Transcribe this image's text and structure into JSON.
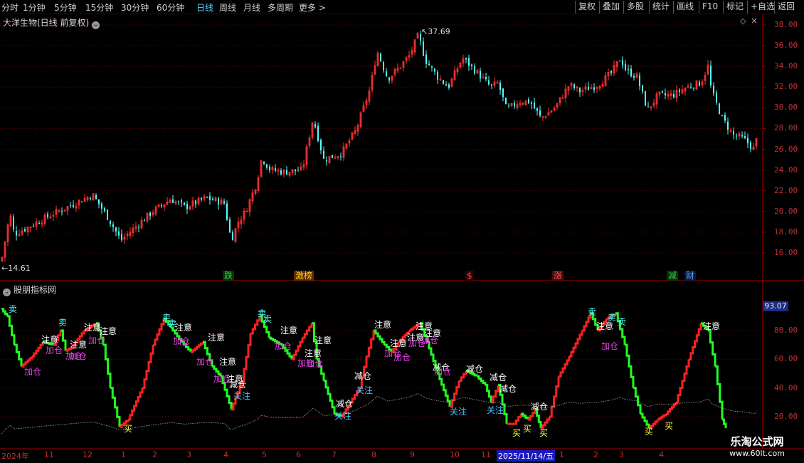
{
  "toolbar": {
    "periods": [
      "分时",
      "1分钟",
      "5分钟",
      "15分钟",
      "30分钟",
      "60分钟",
      "日线",
      "周线",
      "月线",
      "多周期",
      "更多 >"
    ],
    "active_period": "日线",
    "actions": [
      "复权",
      "叠加",
      "多股",
      "统计",
      "画线",
      "F10",
      "标记",
      "+自选",
      "返回"
    ]
  },
  "main_chart": {
    "title": "大洋生物(日线 前复权)",
    "high_label": "37.69",
    "low_label": "14.61",
    "y_ticks": [
      "38.00",
      "36.00",
      "34.00",
      "32.00",
      "30.00",
      "28.00",
      "26.00",
      "24.00",
      "22.00",
      "20.00",
      "18.00",
      "16.00"
    ],
    "events": [
      {
        "text": "跌",
        "color": "#30d040",
        "bg": "#083008"
      },
      {
        "text": "激榜",
        "color": "#ffcc33",
        "bg": "#5a2a00"
      },
      {
        "text": "$",
        "color": "#ff4040",
        "bg": "#300000"
      },
      {
        "text": "涨",
        "color": "#ff5050",
        "bg": "#401010"
      },
      {
        "text": "减",
        "color": "#30d040",
        "bg": "#083008"
      },
      {
        "text": "财",
        "color": "#60a0ff",
        "bg": "#08183a"
      }
    ],
    "colors": {
      "up": "#ff3232",
      "down": "#54ffff",
      "grid": "#6a0000"
    }
  },
  "indicator": {
    "title": "股朋指标网",
    "current_value": "93.07",
    "y_ticks": [
      "80.00",
      "60.00",
      "40.00",
      "20.00"
    ],
    "signals": {
      "sell": "卖",
      "attention": "注意",
      "add": "加仓",
      "reduce": "减仓",
      "watch": "关注",
      "buy": "买"
    },
    "colors": {
      "up": "#ff2020",
      "down": "#20ff20",
      "sell": "#54ffff",
      "attention": "#ffffff",
      "add": "#e040e0",
      "reduce": "#ffffff",
      "watch": "#40c0ff",
      "buy": "#ffff40"
    }
  },
  "date_axis": {
    "labels": [
      "2024年",
      "11",
      "12",
      "1",
      "2",
      "3",
      "4",
      "5",
      "6",
      "7",
      "8",
      "9",
      "10",
      "11",
      "2025/11/14/五",
      "1",
      "2",
      "3",
      "4"
    ]
  },
  "watermark": {
    "name": "乐淘公式网",
    "url": "www.60lt.com"
  }
}
